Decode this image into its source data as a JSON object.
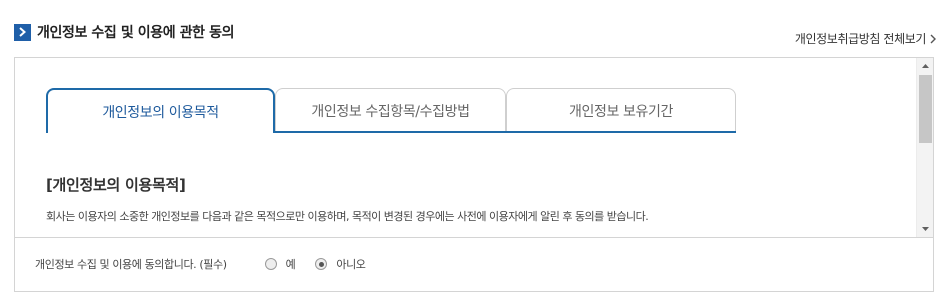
{
  "header": {
    "title": "개인정보 수집 및 이용에 관한 동의",
    "icon": "chevron-right-icon",
    "accent_color": "#1f5fa8",
    "view_all_link": "개인정보취급방침 전체보기"
  },
  "tabs": [
    {
      "label": "개인정보의 이용목적",
      "active": true
    },
    {
      "label": "개인정보 수집항목/수집방법",
      "active": false
    },
    {
      "label": "개인정보 보유기간",
      "active": false
    }
  ],
  "content": {
    "title": "[개인정보의 이용목적]",
    "text": "회사는 이용자의 소중한 개인정보를 다음과 같은 목적으로만 이용하며, 목적이 변경된 경우에는 사전에 이용자에게 알린 후 동의를 받습니다."
  },
  "consent": {
    "label": "개인정보 수집 및 이용에 동의합니다. (필수)",
    "options": [
      {
        "label": "예",
        "selected": false
      },
      {
        "label": "아니오",
        "selected": true
      }
    ]
  }
}
